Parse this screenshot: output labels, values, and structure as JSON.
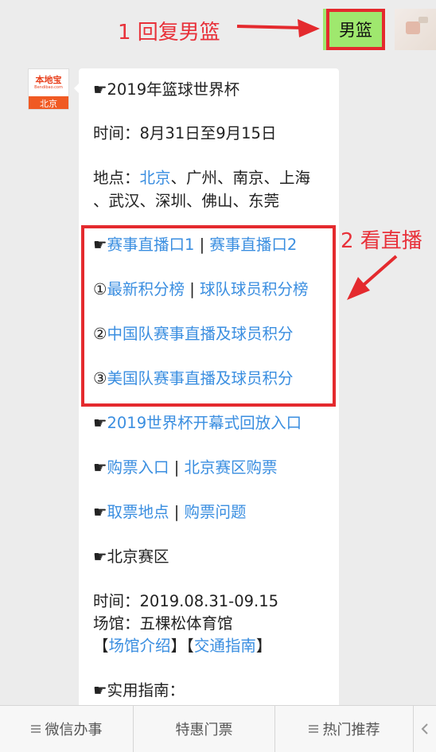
{
  "annotations": {
    "step1": "1 回复男篮",
    "step2": "2 看直播"
  },
  "reply": {
    "text": "男篮"
  },
  "account_logo": {
    "name": "本地宝",
    "domain": "Bendibao.com",
    "city": "北京"
  },
  "article": {
    "title_icon": "☛",
    "title": "2019年篮球世界杯",
    "time_label": "时间：",
    "time_value": "8月31日至9月15日",
    "place_label": "地点：",
    "place_link": "北京",
    "place_rest": "、广州、南京、上海",
    "place_rest2": "、武汉、深圳、佛山、东莞",
    "live_link_1": "赛事直播口1",
    "live_link_2": "赛事直播口2",
    "sep": " | ",
    "rank_num": "①",
    "rank_link_1": "最新积分榜",
    "rank_link_2": "球队球员积分榜",
    "china_num": "②",
    "china_link": "中国队赛事直播及球员积分",
    "usa_num": "③",
    "usa_link": "美国队赛事直播及球员积分",
    "opening_link": "2019世界杯开幕式回放入口",
    "ticket_link_1": "购票入口",
    "ticket_link_2": "北京赛区购票",
    "pickup_link_1": "取票地点",
    "pickup_link_2": "购票问题",
    "beijing_title": "北京赛区",
    "beijing_time_label": "时间：",
    "beijing_time_value": "2019.08.31-09.15",
    "venue_label": "场馆：",
    "venue_value": "五棵松体育馆",
    "bracket_open": "【",
    "bracket_close": "】",
    "venue_intro_link": "场馆介绍",
    "traffic_link": "交通指南",
    "guide_title": "实用指南："
  },
  "bottom_menu": [
    {
      "label": "微信办事",
      "has_menu_icon": true
    },
    {
      "label": "特惠门票",
      "has_menu_icon": false
    },
    {
      "label": "热门推荐",
      "has_menu_icon": true
    }
  ],
  "colors": {
    "link": "#3a8ee0",
    "annotation": "#e8313a",
    "bubble_green": "#9fe86e"
  }
}
